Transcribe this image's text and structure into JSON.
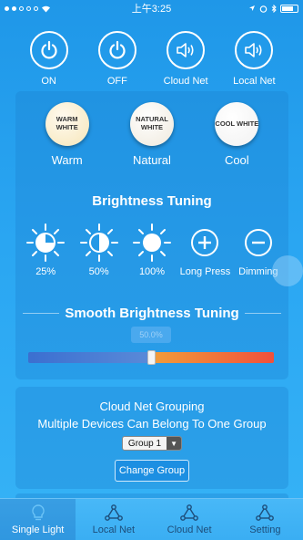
{
  "status_bar": {
    "carrier_signal": "●●○○○",
    "time": "上午3:25"
  },
  "top_controls": [
    {
      "label": "ON",
      "icon": "power-icon"
    },
    {
      "label": "OFF",
      "icon": "power-icon"
    },
    {
      "label": "Cloud Net",
      "icon": "speaker-icon"
    },
    {
      "label": "Local Net",
      "icon": "speaker-icon"
    }
  ],
  "whites": [
    {
      "ball_text": "WARM WHITE",
      "label": "Warm"
    },
    {
      "ball_text": "NATURAL WHITE",
      "label": "Natural"
    },
    {
      "ball_text": "COOL WHITE",
      "label": "Cool"
    }
  ],
  "brightness": {
    "title": "Brightness Tuning",
    "items": [
      {
        "label": "25%",
        "icon": "sun-quarter-icon"
      },
      {
        "label": "50%",
        "icon": "sun-half-icon"
      },
      {
        "label": "100%",
        "icon": "sun-full-icon"
      },
      {
        "label": "Long Press",
        "icon": "plus-circle-icon"
      },
      {
        "label": "Dimming",
        "icon": "minus-circle-icon"
      }
    ]
  },
  "smooth": {
    "title": "Smooth Brightness Tuning",
    "value_label": "50.0%",
    "value": 0.5
  },
  "group": {
    "title": "Cloud Net Grouping",
    "subtitle": "Multiple Devices Can Belong To One Group",
    "selected": "Group 1",
    "change_label": "Change Group"
  },
  "tabs": [
    {
      "label": "Single Light",
      "active": true
    },
    {
      "label": "Local Net",
      "active": false
    },
    {
      "label": "Cloud Net",
      "active": false
    },
    {
      "label": "Setting",
      "active": false
    }
  ]
}
